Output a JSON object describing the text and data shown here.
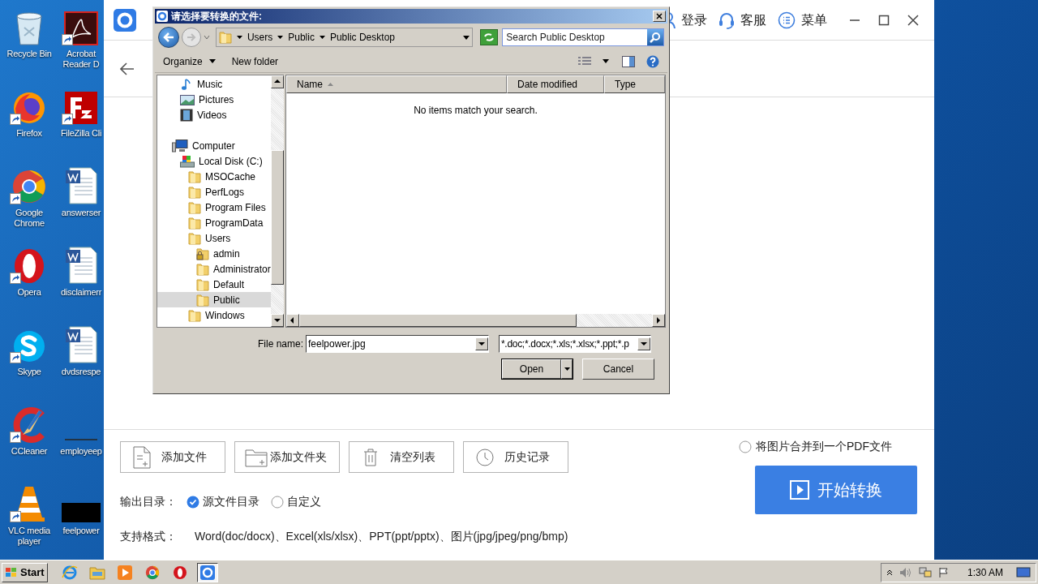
{
  "desktop_icons": [
    {
      "label": "Recycle Bin",
      "kind": "recycle",
      "shortcut": false
    },
    {
      "label": "Acrobat Reader D",
      "kind": "acrobat",
      "shortcut": true
    },
    {
      "label": "Firefox",
      "kind": "firefox",
      "shortcut": true
    },
    {
      "label": "FileZilla Cli",
      "kind": "filezilla",
      "shortcut": true
    },
    {
      "label": "Google Chrome",
      "kind": "chrome",
      "shortcut": true
    },
    {
      "label": "answerser",
      "kind": "word",
      "shortcut": false
    },
    {
      "label": "Opera",
      "kind": "opera",
      "shortcut": true
    },
    {
      "label": "disclaimerr",
      "kind": "word",
      "shortcut": false
    },
    {
      "label": "Skype",
      "kind": "skype",
      "shortcut": true
    },
    {
      "label": "dvdsrespe",
      "kind": "word",
      "shortcut": false
    },
    {
      "label": "CCleaner",
      "kind": "ccleaner",
      "shortcut": true
    },
    {
      "label": "employeep",
      "kind": "blank",
      "shortcut": false
    },
    {
      "label": "VLC media player",
      "kind": "vlc",
      "shortcut": true
    },
    {
      "label": "feelpower",
      "kind": "thumb",
      "shortcut": false
    }
  ],
  "app": {
    "header_actions": [
      {
        "label": "登录",
        "kind": "user"
      },
      {
        "label": "客服",
        "kind": "headset"
      },
      {
        "label": "菜单",
        "kind": "menu"
      }
    ],
    "buttons": [
      {
        "label": "添加文件",
        "kind": "file"
      },
      {
        "label": "添加文件夹",
        "kind": "folder"
      },
      {
        "label": "清空列表",
        "kind": "trash"
      },
      {
        "label": "历史记录",
        "kind": "clock"
      }
    ],
    "output": {
      "label": "输出目录：",
      "options": [
        {
          "label": "源文件目录",
          "selected": true
        },
        {
          "label": "自定义",
          "selected": false
        }
      ]
    },
    "formats": {
      "label": "支持格式：",
      "text": "Word(doc/docx)、Excel(xls/xlsx)、PPT(ppt/pptx)、图片(jpg/jpeg/png/bmp)"
    },
    "merge_option": {
      "label": "将图片合并到一个PDF文件",
      "checked": false
    },
    "start_button": "开始转换"
  },
  "dialog": {
    "title": "请选择要转换的文件:",
    "breadcrumb": [
      "Users",
      "Public",
      "Public Desktop"
    ],
    "search": {
      "placeholder": "Search Public Desktop"
    },
    "toolbar": {
      "organize": "Organize",
      "new_folder": "New folder"
    },
    "library_items": [
      {
        "label": "Music",
        "kind": "music",
        "selected": false
      },
      {
        "label": "Pictures",
        "kind": "pictures",
        "selected": false
      },
      {
        "label": "Videos",
        "kind": "videos",
        "selected": false
      }
    ],
    "tree": [
      {
        "label": "Computer",
        "kind": "computer",
        "selected": false,
        "children": [
          {
            "label": "Local Disk (C:)",
            "kind": "drive",
            "selected": false,
            "children": [
              {
                "label": "MSOCache",
                "kind": "folder",
                "selected": false
              },
              {
                "label": "PerfLogs",
                "kind": "folder",
                "selected": false
              },
              {
                "label": "Program Files",
                "kind": "folder",
                "selected": false
              },
              {
                "label": "ProgramData",
                "kind": "folder",
                "selected": false
              },
              {
                "label": "Users",
                "kind": "folder",
                "selected": false,
                "children": [
                  {
                    "label": "admin",
                    "kind": "locked",
                    "selected": false
                  },
                  {
                    "label": "Administrator",
                    "kind": "folder",
                    "selected": false
                  },
                  {
                    "label": "Default",
                    "kind": "folder",
                    "selected": false
                  },
                  {
                    "label": "Public",
                    "kind": "folder",
                    "selected": true
                  }
                ]
              },
              {
                "label": "Windows",
                "kind": "folder",
                "selected": false
              }
            ]
          }
        ]
      }
    ],
    "columns": [
      {
        "label": "Name",
        "sorted": true
      },
      {
        "label": "Date modified",
        "sorted": false
      },
      {
        "label": "Type",
        "sorted": false
      }
    ],
    "empty_message": "No items match your search.",
    "file_name_label": "File name:",
    "file_name": "feelpower.jpg",
    "filter": "*.doc;*.docx;*.xls;*.xlsx;*.ppt;*.p",
    "open": "Open",
    "cancel": "Cancel"
  },
  "taskbar": {
    "start": "Start",
    "items": [
      {
        "kind": "ie",
        "selected": false
      },
      {
        "kind": "explorer",
        "selected": false
      },
      {
        "kind": "media",
        "selected": false
      },
      {
        "kind": "chrome",
        "selected": false
      },
      {
        "kind": "opera",
        "selected": false
      },
      {
        "kind": "app",
        "selected": true
      }
    ],
    "clock": "1:30 AM"
  }
}
